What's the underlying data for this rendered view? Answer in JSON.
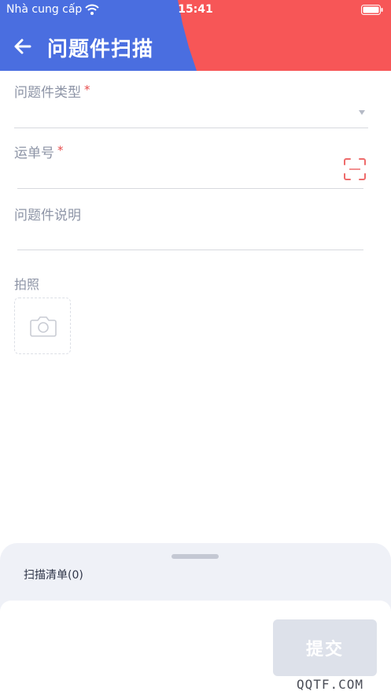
{
  "status_bar": {
    "carrier": "Nhà cung cấp",
    "time": "15:41"
  },
  "header": {
    "title": "问题件扫描",
    "colors": {
      "left": "#4a6ee0",
      "right": "#f75657"
    }
  },
  "form": {
    "type_field": {
      "label": "问题件类型",
      "required_mark": "*",
      "value": ""
    },
    "waybill_field": {
      "label": "运单号",
      "required_mark": "*",
      "value": ""
    },
    "description_field": {
      "label": "问题件说明",
      "value": ""
    },
    "photo_field": {
      "label": "拍照"
    }
  },
  "sheet": {
    "title": "扫描清单(0)",
    "submit_label": "提交"
  },
  "watermark": "QQTF.COM",
  "icons": [
    "wifi-icon",
    "battery-icon",
    "back-arrow-icon",
    "dropdown-arrow-icon",
    "scan-icon",
    "camera-icon"
  ]
}
